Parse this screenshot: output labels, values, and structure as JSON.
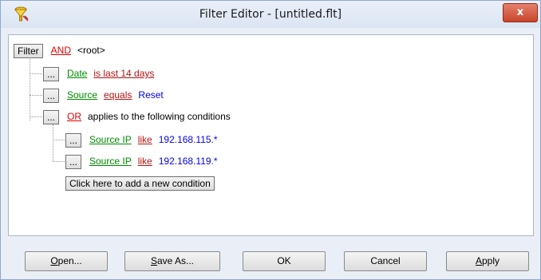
{
  "window": {
    "title": "Filter Editor - [untitled.flt]",
    "close_label": "x"
  },
  "tree": {
    "root": {
      "button": "Filter",
      "operator": "AND",
      "label": "<root>"
    },
    "conditions": [
      {
        "button": "...",
        "field": "Date",
        "condition": "is last 14 days",
        "value": ""
      },
      {
        "button": "...",
        "field": "Source",
        "condition": "equals",
        "value": "Reset"
      }
    ],
    "group": {
      "button": "...",
      "operator": "OR",
      "label": "applies to the following conditions",
      "conditions": [
        {
          "button": "...",
          "field": "Source IP",
          "condition": "like",
          "value": "192.168.115.*"
        },
        {
          "button": "...",
          "field": "Source IP",
          "condition": "like",
          "value": "192.168.119.*"
        }
      ]
    },
    "add_condition_label": "Click here to add a new condition"
  },
  "buttons": {
    "open": {
      "mnemonic": "O",
      "rest": "pen..."
    },
    "save_as": {
      "mnemonic": "S",
      "rest": "ave As..."
    },
    "ok": "OK",
    "cancel": "Cancel",
    "apply": {
      "mnemonic": "A",
      "rest": "pply"
    }
  },
  "colors": {
    "operator": "#e00000",
    "field": "#008a00",
    "condition": "#b01414",
    "value": "#0000ee",
    "close_button": "#c94529"
  }
}
